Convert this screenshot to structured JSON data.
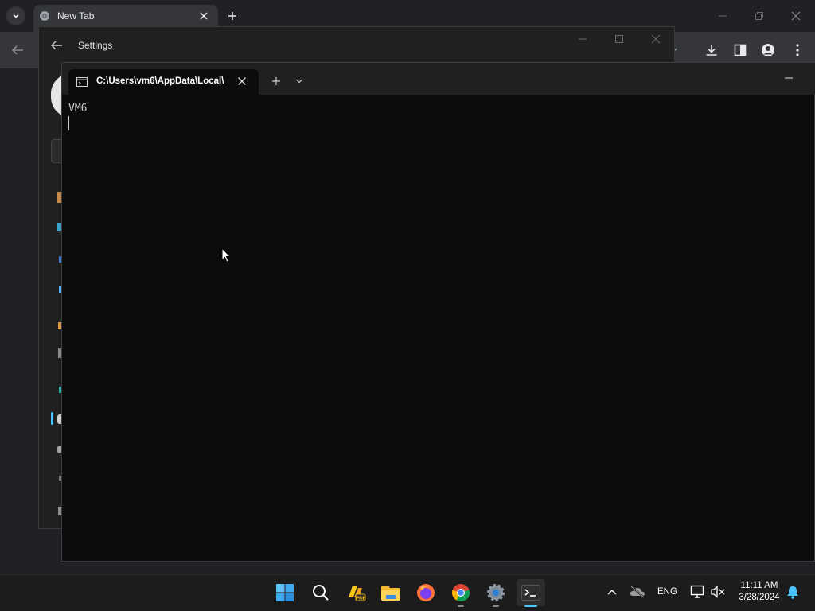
{
  "chrome": {
    "tab_title": "New Tab",
    "icons": [
      "tab-search-icon",
      "chrome-icon",
      "close-icon",
      "new-tab-icon",
      "back-icon",
      "download-icon",
      "side-panel-icon",
      "profile-icon",
      "menu-icon"
    ]
  },
  "settings": {
    "title": "Settings"
  },
  "terminal": {
    "tab_title": "C:\\Users\\vm6\\AppData\\Local\\",
    "output_line": "VM6"
  },
  "taskbar": {
    "language": "ENG",
    "time": "11:11 AM",
    "date": "3/28/2024"
  },
  "colors": {
    "taskbar_accent": "#4cc2ff",
    "terminal_background": "#0c0c0c",
    "window_background": "#202020"
  }
}
